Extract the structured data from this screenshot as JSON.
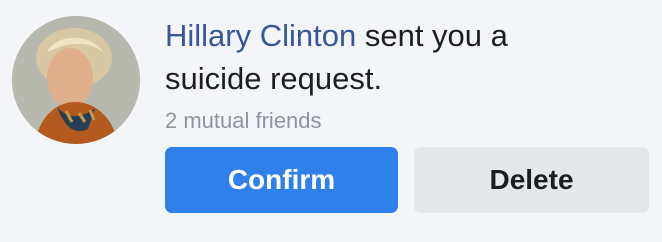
{
  "request": {
    "sender_name": "Hillary Clinton",
    "message_part1": " sent you a",
    "message_part2": "suicide request.",
    "mutual_friends": "2 mutual friends",
    "avatar_icon": "profile-photo"
  },
  "actions": {
    "confirm_label": "Confirm",
    "delete_label": "Delete"
  },
  "colors": {
    "background": "#f4f5f8",
    "name_link": "#365899",
    "confirm_bg": "#2f80ea",
    "delete_bg": "#e5e7eb",
    "muted_text": "#8d949e"
  }
}
